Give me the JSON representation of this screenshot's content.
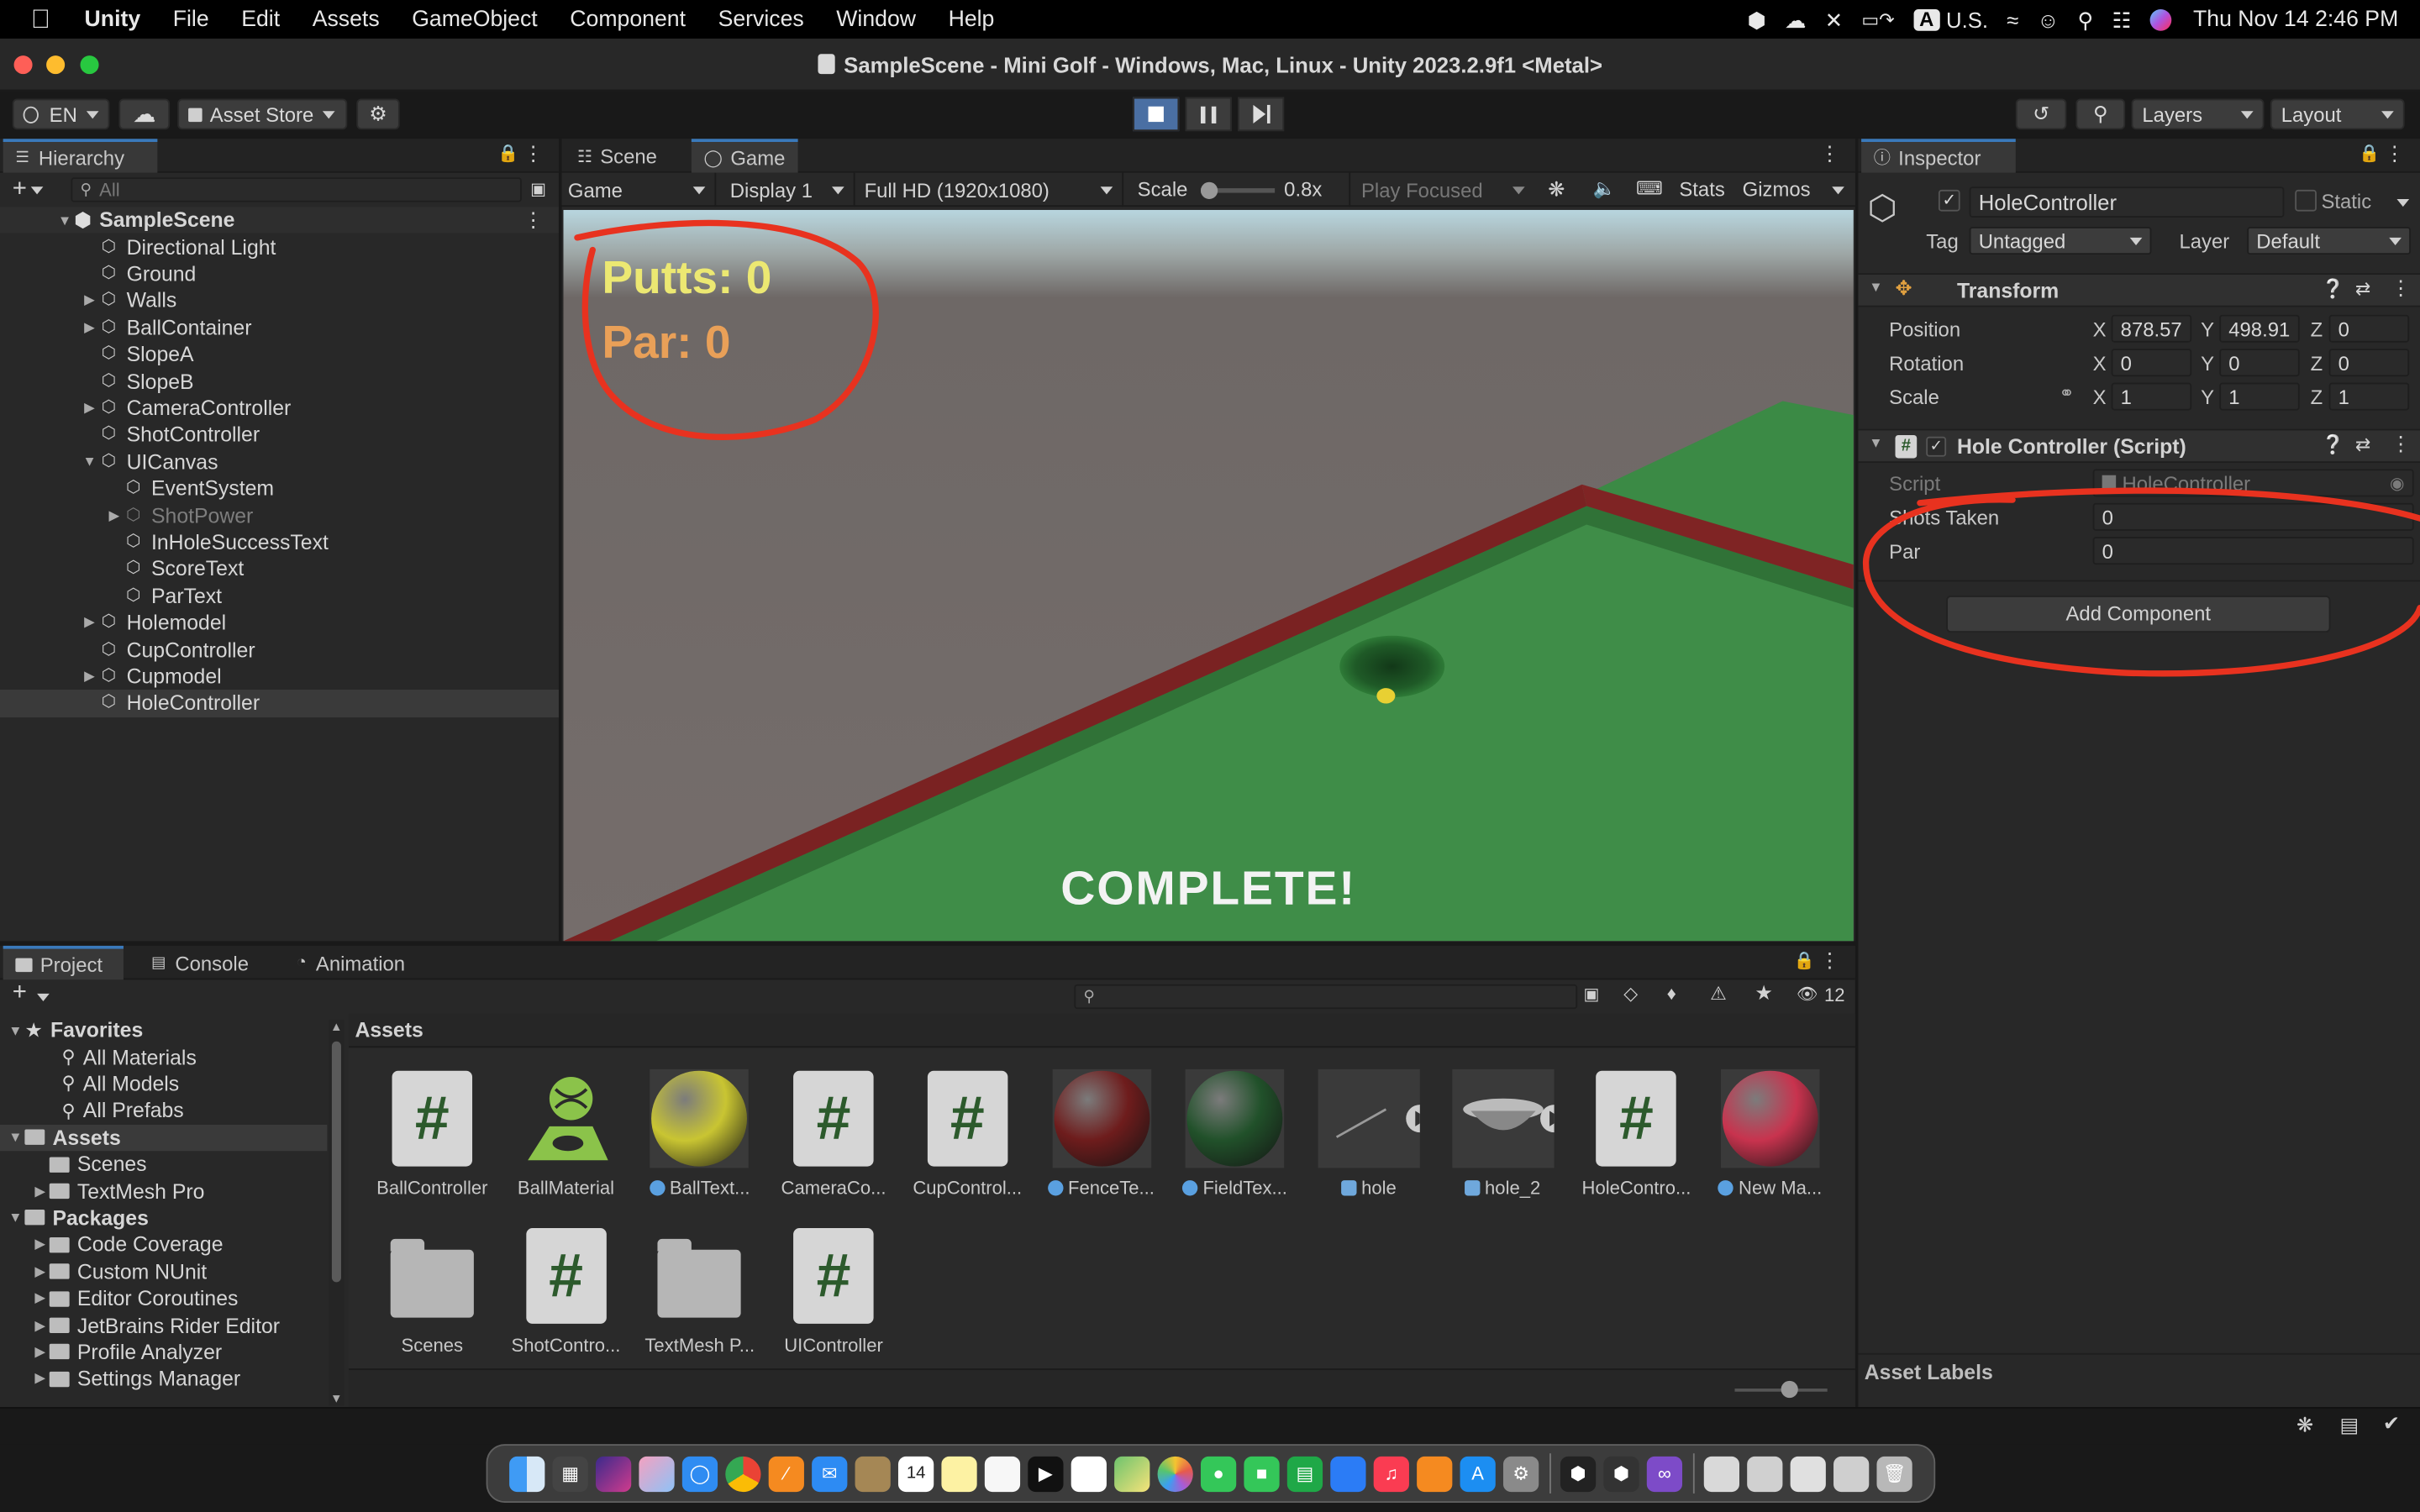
{
  "menubar": {
    "app": "Unity",
    "items": [
      "File",
      "Edit",
      "Assets",
      "GameObject",
      "Component",
      "Services",
      "Window",
      "Help"
    ],
    "input_source": "U.S.",
    "input_badge": "A",
    "clock": "Thu Nov 14  2:46 PM"
  },
  "window": {
    "title": "SampleScene - Mini Golf - Windows, Mac, Linux - Unity 2023.2.9f1 <Metal>"
  },
  "toolbar": {
    "account": "EN",
    "asset_store": "Asset Store",
    "layers": "Layers",
    "layout": "Layout"
  },
  "hierarchy": {
    "tab": "Hierarchy",
    "search_placeholder": "All",
    "scene": "SampleScene",
    "items": [
      {
        "label": "Directional Light",
        "depth": 1,
        "arrow": false
      },
      {
        "label": "Ground",
        "depth": 1,
        "arrow": false
      },
      {
        "label": "Walls",
        "depth": 1,
        "arrow": true,
        "open": false
      },
      {
        "label": "BallContainer",
        "depth": 1,
        "arrow": true,
        "open": false
      },
      {
        "label": "SlopeA",
        "depth": 1,
        "arrow": false
      },
      {
        "label": "SlopeB",
        "depth": 1,
        "arrow": false
      },
      {
        "label": "CameraController",
        "depth": 1,
        "arrow": true,
        "open": false
      },
      {
        "label": "ShotController",
        "depth": 1,
        "arrow": false
      },
      {
        "label": "UICanvas",
        "depth": 1,
        "arrow": true,
        "open": true
      },
      {
        "label": "EventSystem",
        "depth": 2,
        "arrow": false
      },
      {
        "label": "ShotPower",
        "depth": 2,
        "arrow": true,
        "open": false,
        "dim": true
      },
      {
        "label": "InHoleSuccessText",
        "depth": 2,
        "arrow": false
      },
      {
        "label": "ScoreText",
        "depth": 2,
        "arrow": false
      },
      {
        "label": "ParText",
        "depth": 2,
        "arrow": false
      },
      {
        "label": "Holemodel",
        "depth": 1,
        "arrow": true,
        "open": false
      },
      {
        "label": "CupController",
        "depth": 1,
        "arrow": false
      },
      {
        "label": "Cupmodel",
        "depth": 1,
        "arrow": true,
        "open": false
      },
      {
        "label": "HoleController",
        "depth": 1,
        "arrow": false,
        "selected": true
      }
    ]
  },
  "game_view": {
    "tabs": [
      "Scene",
      "Game"
    ],
    "mode": "Game",
    "display": "Display 1",
    "resolution": "Full HD (1920x1080)",
    "scale_label": "Scale",
    "scale_value": "0.8x",
    "play_focused": "Play Focused",
    "stats": "Stats",
    "gizmos": "Gizmos",
    "putts": "Putts: 0",
    "par": "Par: 0",
    "complete": "COMPLETE!"
  },
  "inspector": {
    "tab": "Inspector",
    "object_name": "HoleController",
    "static_label": "Static",
    "tag_label": "Tag",
    "tag_value": "Untagged",
    "layer_label": "Layer",
    "layer_value": "Default",
    "transform": {
      "header": "Transform",
      "position_label": "Position",
      "rotation_label": "Rotation",
      "scale_label": "Scale",
      "axis_x": "X",
      "axis_y": "Y",
      "axis_z": "Z",
      "position": [
        "878.57",
        "498.91",
        "0"
      ],
      "rotation": [
        "0",
        "0",
        "0"
      ],
      "scale": [
        "1",
        "1",
        "1"
      ]
    },
    "script_component": {
      "header": "Hole Controller (Script)",
      "script_label": "Script",
      "script_value": "HoleController",
      "shots_label": "Shots Taken",
      "shots_value": "0",
      "par_label": "Par",
      "par_value": "0"
    },
    "add_component": "Add Component",
    "asset_labels": "Asset Labels"
  },
  "project": {
    "tabs": [
      "Project",
      "Console",
      "Animation"
    ],
    "badge_count": "12",
    "tree": [
      {
        "label": "Favorites",
        "depth": 0,
        "arrow": true,
        "bold": true,
        "icon": "star"
      },
      {
        "label": "All Materials",
        "depth": 1,
        "icon": "search"
      },
      {
        "label": "All Models",
        "depth": 1,
        "icon": "search"
      },
      {
        "label": "All Prefabs",
        "depth": 1,
        "icon": "search"
      },
      {
        "label": "Assets",
        "depth": 0,
        "arrow": true,
        "bold": true,
        "icon": "folder",
        "selected": true
      },
      {
        "label": "Scenes",
        "depth": 1,
        "icon": "folder"
      },
      {
        "label": "TextMesh Pro",
        "depth": 1,
        "arrow": true,
        "icon": "folder"
      },
      {
        "label": "Packages",
        "depth": 0,
        "arrow": true,
        "bold": true,
        "icon": "folder"
      },
      {
        "label": "Code Coverage",
        "depth": 1,
        "arrow": true,
        "icon": "folder"
      },
      {
        "label": "Custom NUnit",
        "depth": 1,
        "arrow": true,
        "icon": "folder"
      },
      {
        "label": "Editor Coroutines",
        "depth": 1,
        "arrow": true,
        "icon": "folder"
      },
      {
        "label": "JetBrains Rider Editor",
        "depth": 1,
        "arrow": true,
        "icon": "folder"
      },
      {
        "label": "Profile Analyzer",
        "depth": 1,
        "arrow": true,
        "icon": "folder"
      },
      {
        "label": "Settings Manager",
        "depth": 1,
        "arrow": true,
        "icon": "folder"
      }
    ],
    "breadcrumb": "Assets",
    "assets": [
      {
        "label": "BallController",
        "kind": "script"
      },
      {
        "label": "BallMaterial",
        "kind": "physmat"
      },
      {
        "label": "BallText...",
        "kind": "sphere",
        "color": "#c9c532",
        "badge": true
      },
      {
        "label": "CameraCo...",
        "kind": "script"
      },
      {
        "label": "CupControl...",
        "kind": "script"
      },
      {
        "label": "FenceTe...",
        "kind": "sphere",
        "color": "#6e1c1c",
        "badge": true
      },
      {
        "label": "FieldTex...",
        "kind": "sphere",
        "color": "#21512a",
        "badge": true
      },
      {
        "label": "hole",
        "kind": "model",
        "badge": true
      },
      {
        "label": "hole_2",
        "kind": "model2",
        "badge": true
      },
      {
        "label": "HoleContro...",
        "kind": "script"
      },
      {
        "label": "New Ma...",
        "kind": "sphere",
        "color": "#c8334e",
        "badge": true
      },
      {
        "label": "Scenes",
        "kind": "folder"
      },
      {
        "label": "ShotContro...",
        "kind": "script"
      },
      {
        "label": "TextMesh P...",
        "kind": "folder"
      },
      {
        "label": "UIController",
        "kind": "script"
      }
    ]
  },
  "dock": {
    "calendar_day": "14"
  }
}
